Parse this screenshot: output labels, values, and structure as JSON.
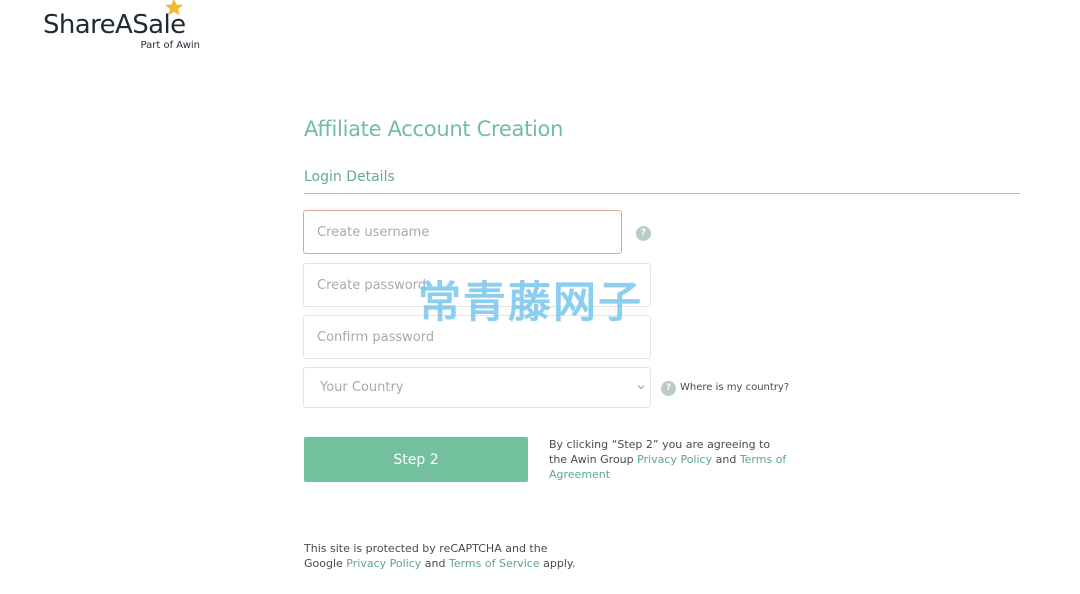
{
  "brand": {
    "name": "ShareASale",
    "subtitle": "Part of Awin",
    "star_color": "#f5b82e"
  },
  "page": {
    "title": "Affiliate Account Creation",
    "section_title": "Login Details"
  },
  "form": {
    "username_placeholder": "Create username",
    "username_value": "",
    "password_placeholder": "Create password",
    "password_value": "",
    "confirm_placeholder": "Confirm password",
    "confirm_value": "",
    "country_selected": "Your Country",
    "help_symbol": "?",
    "country_help_link": "Where is my country?"
  },
  "submit": {
    "label": "Step 2"
  },
  "agreement": {
    "text_before": "By clicking “Step 2” you are agreeing to the Awin Group ",
    "privacy_link": "Privacy Policy",
    "middle": " and ",
    "terms_link": "Terms of Agreement"
  },
  "recaptcha": {
    "text_before": "This site is protected by reCAPTCHA and the Google ",
    "privacy_link": "Privacy Policy",
    "middle": " and ",
    "terms_link": "Terms of Service",
    "text_after": " apply."
  },
  "watermark": {
    "text": "常青藤网子"
  },
  "colors": {
    "accent": "#73c09e",
    "title": "#6fbf9c",
    "link": "#5aa884",
    "error_border": "#e2a48e"
  }
}
